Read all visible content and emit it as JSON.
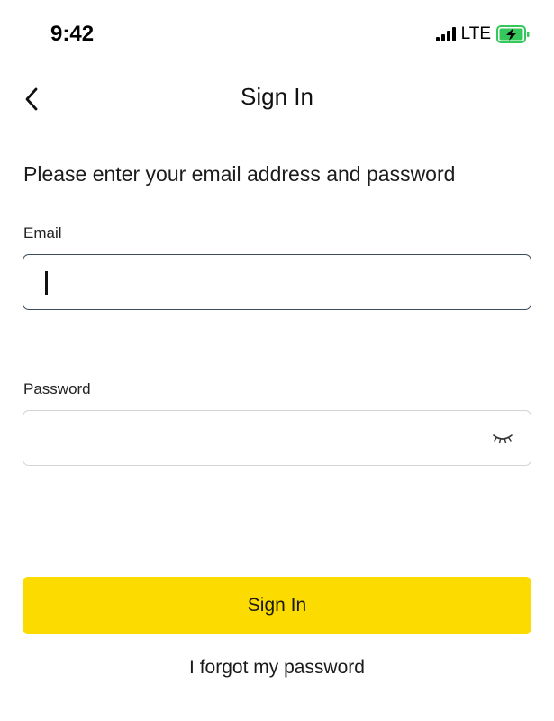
{
  "status_bar": {
    "time": "9:42",
    "network": "LTE",
    "icons": [
      "signal-bars-icon",
      "battery-charging-icon"
    ],
    "battery_color": "#34c759"
  },
  "nav": {
    "title": "Sign In",
    "back_icon": "chevron-left-icon"
  },
  "form": {
    "instruction": "Please enter your email address and password",
    "email": {
      "label": "Email",
      "value": "",
      "focused": true
    },
    "password": {
      "label": "Password",
      "value": "",
      "toggle_icon": "eye-closed-icon"
    }
  },
  "actions": {
    "sign_in_label": "Sign In",
    "forgot_label": "I forgot my password"
  },
  "colors": {
    "accent": "#fcdb00",
    "focused_border": "#3b4a5c",
    "field_border": "#d4d4d4"
  }
}
